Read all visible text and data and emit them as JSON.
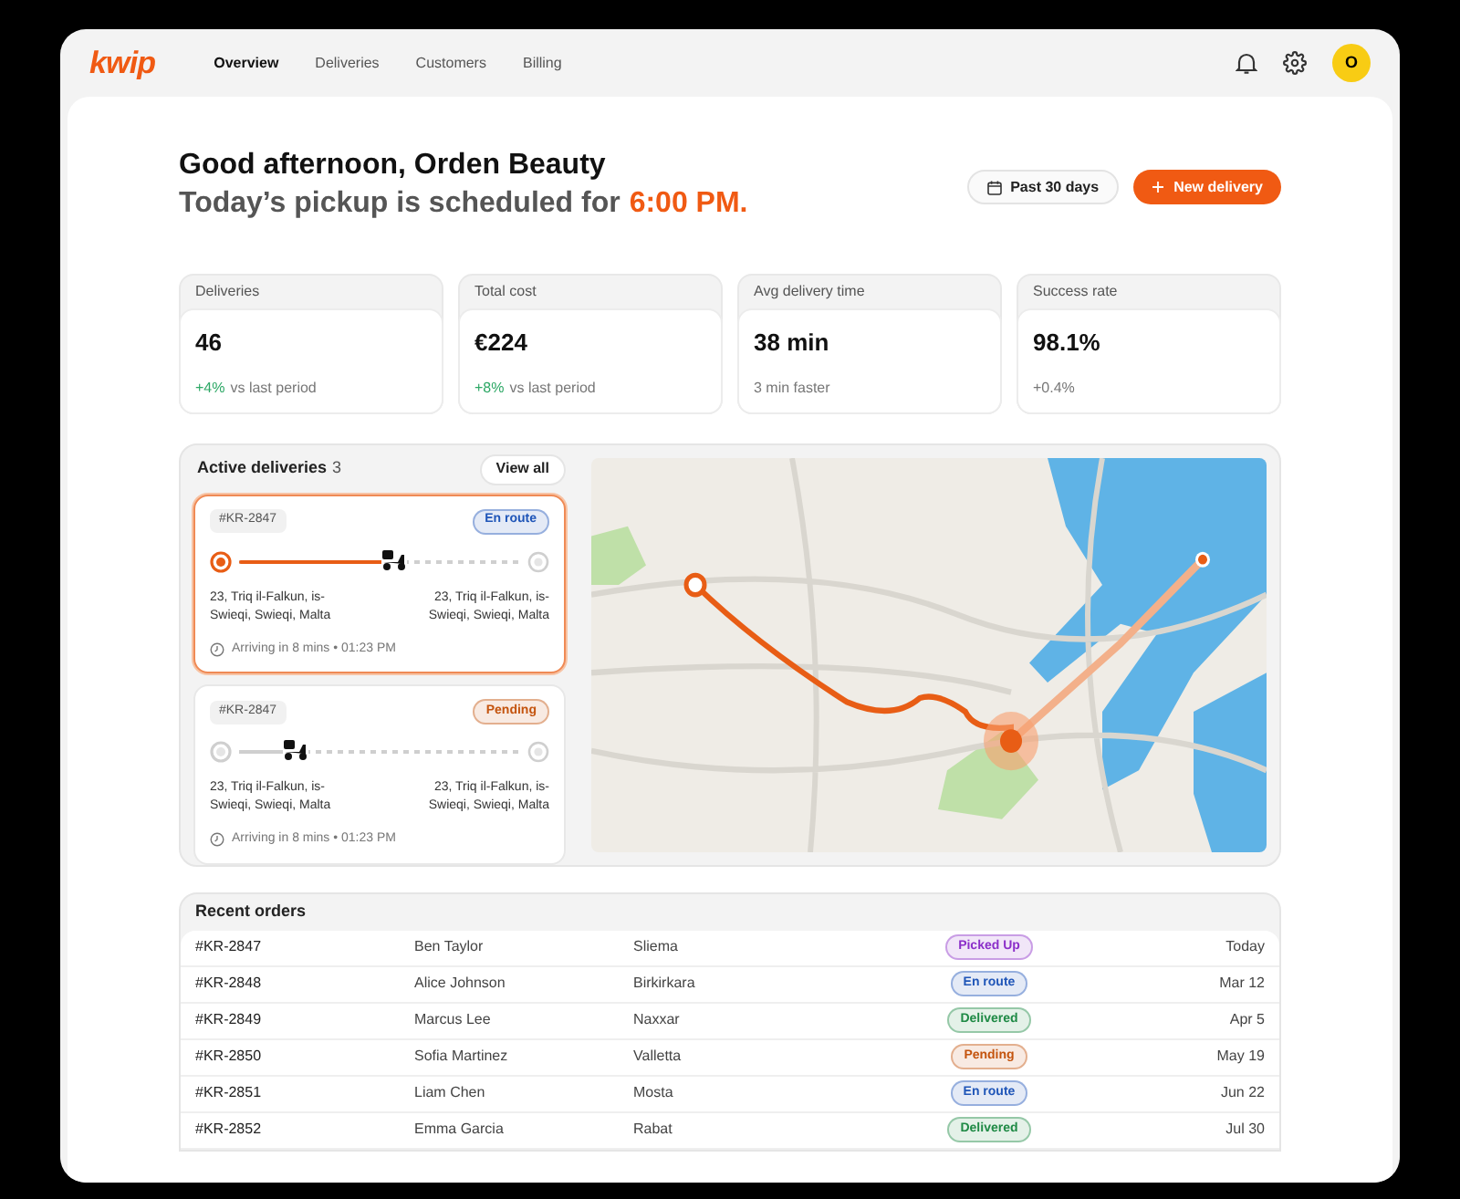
{
  "nav": {
    "logo": "kwip",
    "links": [
      {
        "label": "Overview",
        "selected": true
      },
      {
        "label": "Deliveries",
        "selected": false
      },
      {
        "label": "Customers",
        "selected": false
      },
      {
        "label": "Billing",
        "selected": false
      }
    ],
    "avatar": "O"
  },
  "greeting": {
    "title": "Good afternoon, Orden Beauty",
    "subtitle": "Today’s pickup is scheduled for",
    "time": "6:00 PM."
  },
  "actions": {
    "date_filter": "Past 30 days",
    "new_delivery": "New delivery"
  },
  "stats": [
    {
      "label": "Deliveries",
      "value": "46",
      "change": "+4%",
      "note": "vs last period",
      "color": "#2ea866"
    },
    {
      "label": "Total cost",
      "value": "€224",
      "change": "+8%",
      "note": "vs last period",
      "color": "#2ea866"
    },
    {
      "label": "Avg delivery time",
      "value": "38 min",
      "note": "3 min faster"
    },
    {
      "label": "Success rate",
      "value": "98.1%",
      "note": "+0.4%"
    }
  ],
  "active_deliveries": {
    "title": "Active deliveries",
    "count": "3",
    "view_all": "View all",
    "items": [
      {
        "id": "#KR-2847",
        "status": "En route",
        "color": "#2056b8",
        "selected": true,
        "level": 0.55,
        "from": "23, Triq il-Falkun, is-Swieqi, Swieqi, Malta",
        "to": "23, Triq il-Falkun, is-Swieqi, Swieqi, Malta",
        "meta": "Arriving in 8 mins • 01:23 PM"
      },
      {
        "id": "#KR-2847",
        "status": "Pending",
        "color": "#c4540e",
        "selected": false,
        "level": 0.2,
        "from": "23, Triq il-Falkun, is-Swieqi, Swieqi, Malta",
        "to": "23, Triq il-Falkun, is-Swieqi, Swieqi, Malta",
        "meta": "Arriving in 8 mins • 01:23 PM"
      }
    ]
  },
  "recent_orders": {
    "title": "Recent orders",
    "rows": [
      {
        "id": "#KR-2847",
        "customer": "Ben Taylor",
        "city": "Sliema",
        "status": "Picked Up",
        "color": "#8b2fc9",
        "date": "Today"
      },
      {
        "id": "#KR-2848",
        "customer": "Alice Johnson",
        "city": "Birkirkara",
        "status": "En route",
        "color": "#2056b8",
        "date": "Mar 12"
      },
      {
        "id": "#KR-2849",
        "customer": "Marcus Lee",
        "city": "Naxxar",
        "status": "Delivered",
        "color": "#1f8a45",
        "date": "Apr 5"
      },
      {
        "id": "#KR-2850",
        "customer": "Sofia Martinez",
        "city": "Valletta",
        "status": "Pending",
        "color": "#c4540e",
        "date": "May 19"
      },
      {
        "id": "#KR-2851",
        "customer": "Liam Chen",
        "city": "Mosta",
        "status": "En route",
        "color": "#2056b8",
        "date": "Jun 22"
      },
      {
        "id": "#KR-2852",
        "customer": "Emma Garcia",
        "city": "Rabat",
        "status": "Delivered",
        "color": "#1f8a45",
        "date": "Jul 30"
      }
    ]
  }
}
